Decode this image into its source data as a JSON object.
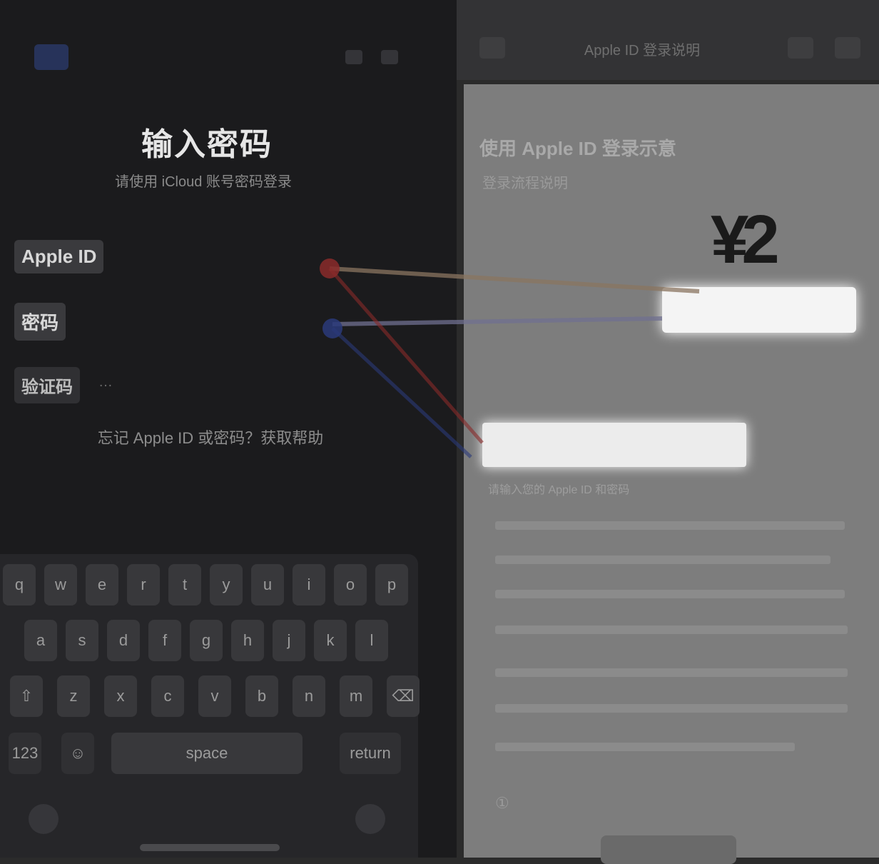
{
  "phone": {
    "title": "输入密码",
    "subtitle": "请使用 iCloud 账号密码登录",
    "fields": [
      {
        "label": "Apple ID",
        "value": ""
      },
      {
        "label": "密码",
        "value": ""
      },
      {
        "label": "验证码",
        "value": "…"
      }
    ],
    "forgot_link": "忘记 Apple ID 或密码？获取帮助",
    "keyboard": {
      "row1": [
        "q",
        "w",
        "e",
        "r",
        "t",
        "y",
        "u",
        "i",
        "o",
        "p"
      ],
      "row2": [
        "a",
        "s",
        "d",
        "f",
        "g",
        "h",
        "j",
        "k",
        "l"
      ],
      "row3": [
        "⇧",
        "z",
        "x",
        "c",
        "v",
        "b",
        "n",
        "m",
        "⌫"
      ],
      "row4": {
        "left": "123",
        "emoji": "☺",
        "space": "space",
        "return": "return"
      }
    },
    "icons": {
      "back": "back-icon",
      "emoji": "emoji-icon",
      "mic": "mic-icon"
    }
  },
  "document": {
    "header_title": "Apple ID 登录说明",
    "heading": "使用 Apple ID 登录示意",
    "subheading": "登录流程说明",
    "figure_label": "¥2",
    "highlight_1": "",
    "highlight_2": "",
    "caption": "请输入您的 Apple ID 和密码",
    "footer_text": "①"
  },
  "colors": {
    "connector_red": "#8a2a2a",
    "connector_blue": "#2a3a7a",
    "connector_tan": "#8a7560",
    "connector_lavender": "#707090"
  }
}
